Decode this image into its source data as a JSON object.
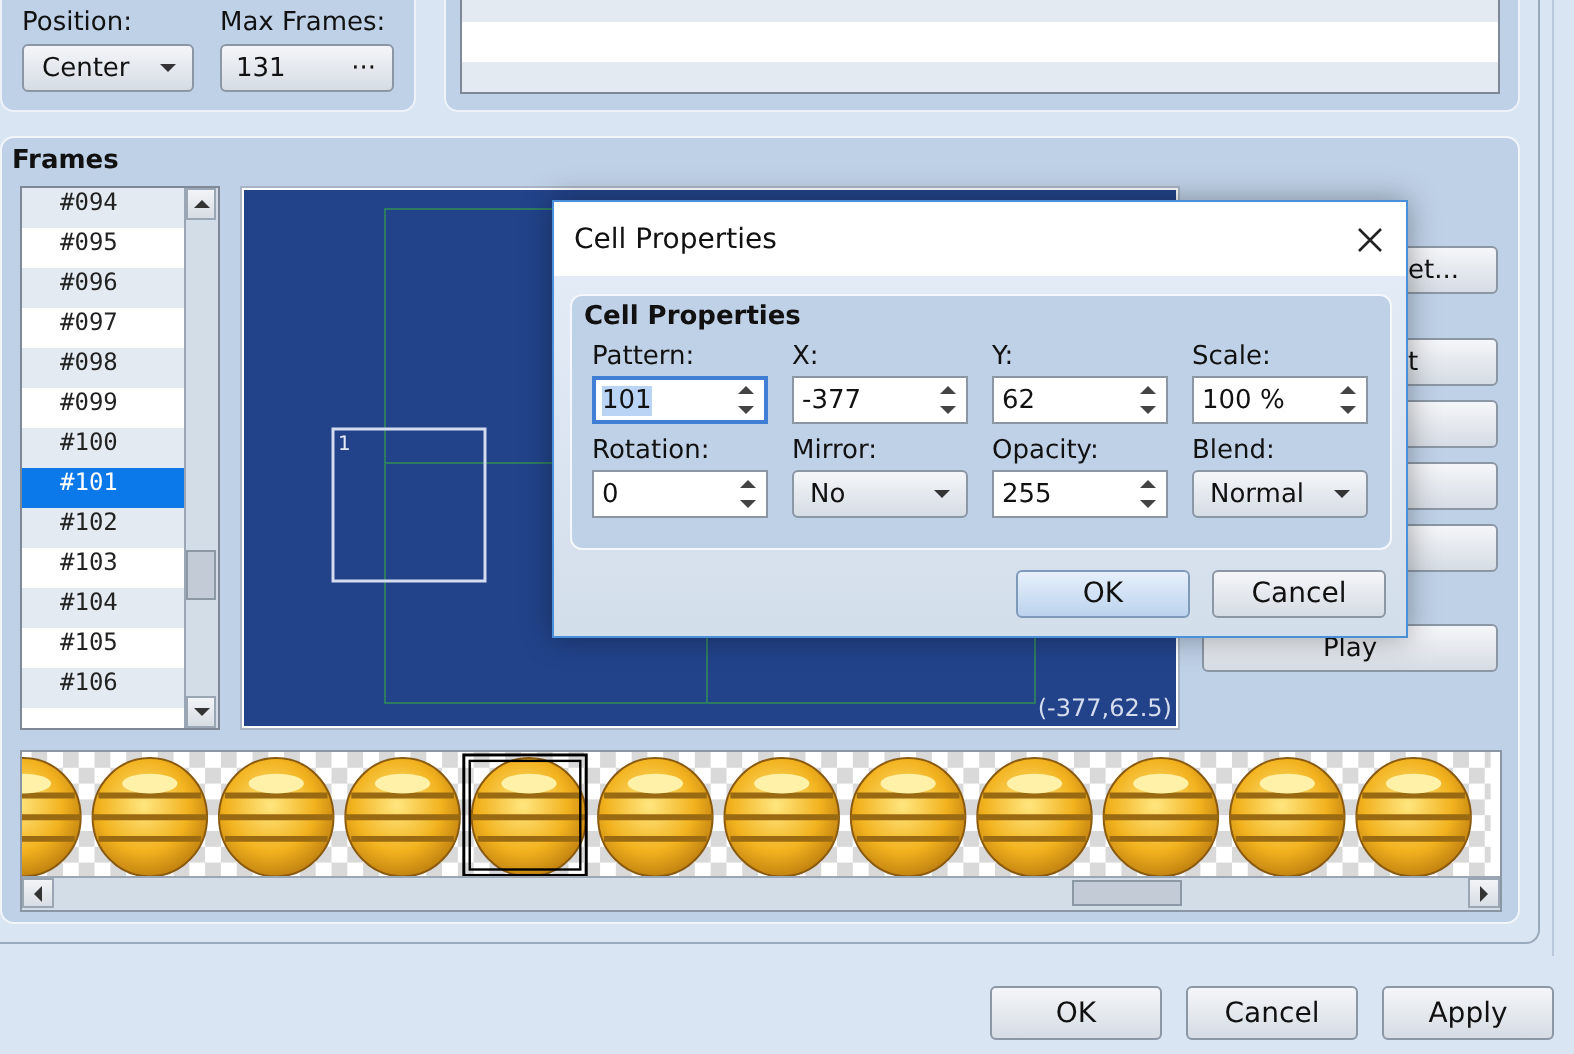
{
  "position": {
    "label": "Position:",
    "value": "Center"
  },
  "max_frames": {
    "label": "Max Frames:",
    "value": "131",
    "button": "···"
  },
  "frames": {
    "title": "Frames",
    "items": [
      {
        "label": "#094",
        "selected": false
      },
      {
        "label": "#095",
        "selected": false
      },
      {
        "label": "#096",
        "selected": false
      },
      {
        "label": "#097",
        "selected": false
      },
      {
        "label": "#098",
        "selected": false
      },
      {
        "label": "#099",
        "selected": false
      },
      {
        "label": "#100",
        "selected": false
      },
      {
        "label": "#101",
        "selected": true
      },
      {
        "label": "#102",
        "selected": false
      },
      {
        "label": "#103",
        "selected": false
      },
      {
        "label": "#104",
        "selected": false
      },
      {
        "label": "#105",
        "selected": false
      },
      {
        "label": "#106",
        "selected": false
      }
    ]
  },
  "canvas": {
    "cell_number": "1",
    "coordinates": "(-377,62.5)"
  },
  "side_buttons": [
    {
      "kind": "labeled",
      "label": "et..."
    },
    {
      "kind": "labeled",
      "label": "t"
    },
    {
      "kind": "blank"
    },
    {
      "kind": "blank"
    },
    {
      "kind": "blank"
    },
    {
      "kind": "labeled",
      "label": "Play"
    }
  ],
  "pattern_strip": {
    "cells": [
      {
        "selected": false
      },
      {
        "selected": false
      },
      {
        "selected": false
      },
      {
        "selected": false
      },
      {
        "selected": true
      },
      {
        "selected": false
      },
      {
        "selected": false
      },
      {
        "selected": false
      },
      {
        "selected": false
      },
      {
        "selected": false
      },
      {
        "selected": false
      },
      {
        "selected": false
      }
    ]
  },
  "dialog": {
    "title": "Cell Properties",
    "group_title": "Cell Properties",
    "fields": [
      {
        "kind": "spin",
        "label": "Pattern:",
        "value": "101",
        "focused": true
      },
      {
        "kind": "spin",
        "label": "X:",
        "value": "-377",
        "focused": false
      },
      {
        "kind": "spin",
        "label": "Y:",
        "value": "62",
        "focused": false
      },
      {
        "kind": "spin",
        "label": "Scale:",
        "value": "100 %",
        "focused": false
      },
      {
        "kind": "spin",
        "label": "Rotation:",
        "value": "0",
        "focused": false
      },
      {
        "kind": "combo",
        "label": "Mirror:",
        "value": "No"
      },
      {
        "kind": "spin",
        "label": "Opacity:",
        "value": "255",
        "focused": false
      },
      {
        "kind": "combo",
        "label": "Blend:",
        "value": "Normal"
      }
    ],
    "buttons": [
      {
        "label": "OK",
        "default": true
      },
      {
        "label": "Cancel",
        "default": false
      }
    ]
  },
  "footer_buttons": [
    "OK",
    "Cancel",
    "Apply"
  ]
}
